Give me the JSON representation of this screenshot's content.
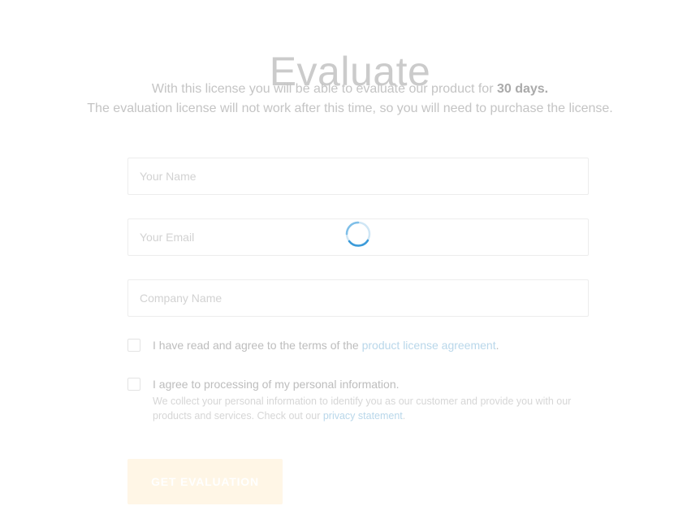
{
  "header": {
    "title": "Evaluate"
  },
  "intro": {
    "line1_prefix": "With this license you will be able to evaluate our product for ",
    "line1_bold": "30 days.",
    "line2": "The evaluation license will not work after this time, so you will need to purchase the license."
  },
  "form": {
    "name": {
      "placeholder": "Your Name",
      "value": ""
    },
    "email": {
      "placeholder": "Your Email",
      "value": ""
    },
    "company": {
      "placeholder": "Company Name",
      "value": ""
    },
    "agree_terms": {
      "text_prefix": "I have read and agree to the terms of the ",
      "link_text": "product license agreement",
      "text_suffix": ".",
      "checked": false
    },
    "agree_personal": {
      "text": "I agree to processing of my personal information.",
      "note_prefix": "We collect your personal information to identify you as our customer and provide you with our products and services. Check out our ",
      "link_text": "privacy statement",
      "note_suffix": ".",
      "checked": false
    },
    "submit_label": "GET EVALUATION"
  },
  "loading": {
    "visible": true
  },
  "colors": {
    "spinner_accent": "#3a9ad9",
    "link": "#b9d7ea",
    "button_bg": "#fff6e6"
  }
}
